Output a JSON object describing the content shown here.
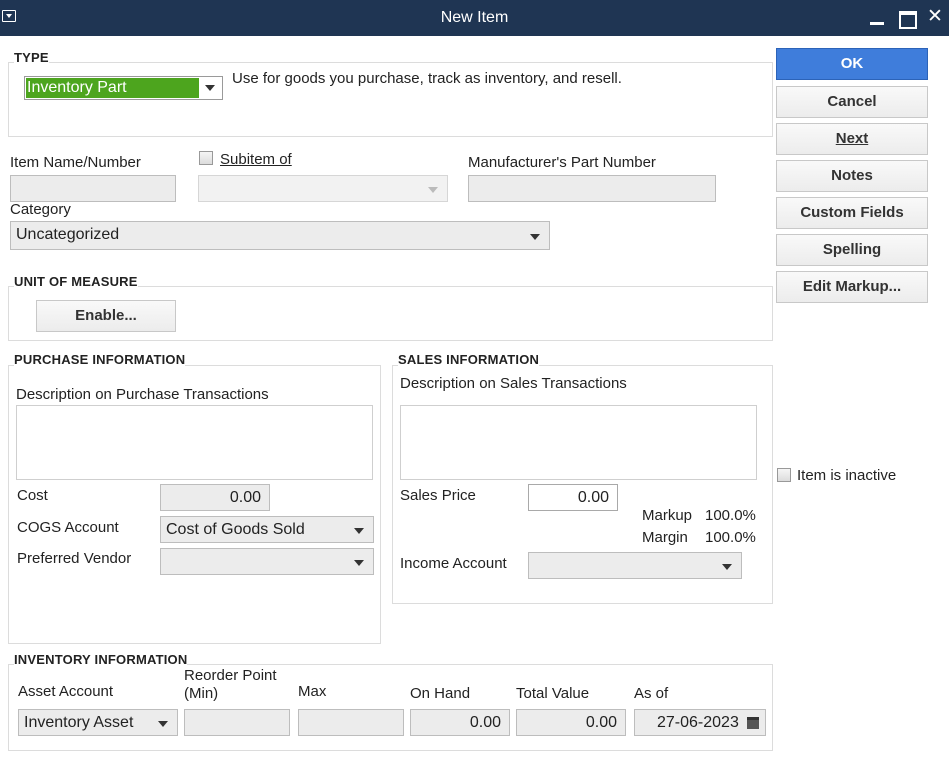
{
  "window": {
    "title": "New Item"
  },
  "type_section": {
    "heading": "TYPE",
    "selected": "Inventory Part",
    "description": "Use for goods you purchase, track as inventory, and resell."
  },
  "item_fields": {
    "item_name_label": "Item Name/Number",
    "subitem_label": "Subitem of",
    "subitem_checked": false,
    "mfr_part_label": "Manufacturer's Part Number",
    "category_label": "Category",
    "category_value": "Uncategorized"
  },
  "unit_of_measure": {
    "heading": "UNIT OF MEASURE",
    "enable_label": "Enable..."
  },
  "purchase": {
    "heading": "PURCHASE INFORMATION",
    "description_label": "Description on Purchase Transactions",
    "cost_label": "Cost",
    "cost_value": "0.00",
    "cogs_label": "COGS Account",
    "cogs_value": "Cost of Goods Sold",
    "vendor_label": "Preferred Vendor"
  },
  "sales": {
    "heading": "SALES INFORMATION",
    "description_label": "Description on Sales Transactions",
    "price_label": "Sales Price",
    "price_value": "0.00",
    "markup_label": "Markup",
    "markup_value": "100.0%",
    "margin_label": "Margin",
    "margin_value": "100.0%",
    "income_label": "Income Account"
  },
  "inventory": {
    "heading": "INVENTORY INFORMATION",
    "asset_label": "Asset Account",
    "asset_value": "Inventory Asset",
    "reorder_label_1": "Reorder Point",
    "reorder_label_2": "(Min)",
    "max_label": "Max",
    "on_hand_label": "On Hand",
    "on_hand_value": "0.00",
    "total_value_label": "Total Value",
    "total_value_value": "0.00",
    "as_of_label": "As of",
    "as_of_value": "27-06-2023"
  },
  "buttons": {
    "ok": "OK",
    "cancel": "Cancel",
    "next": "Next",
    "notes": "Notes",
    "custom_fields": "Custom Fields",
    "spelling": "Spelling",
    "edit_markup": "Edit Markup..."
  },
  "inactive": {
    "label": "Item is inactive",
    "checked": false
  },
  "colors": {
    "titlebar": "#1f3553",
    "type_highlight": "#4da51e",
    "ok_button": "#3f7ddb"
  }
}
